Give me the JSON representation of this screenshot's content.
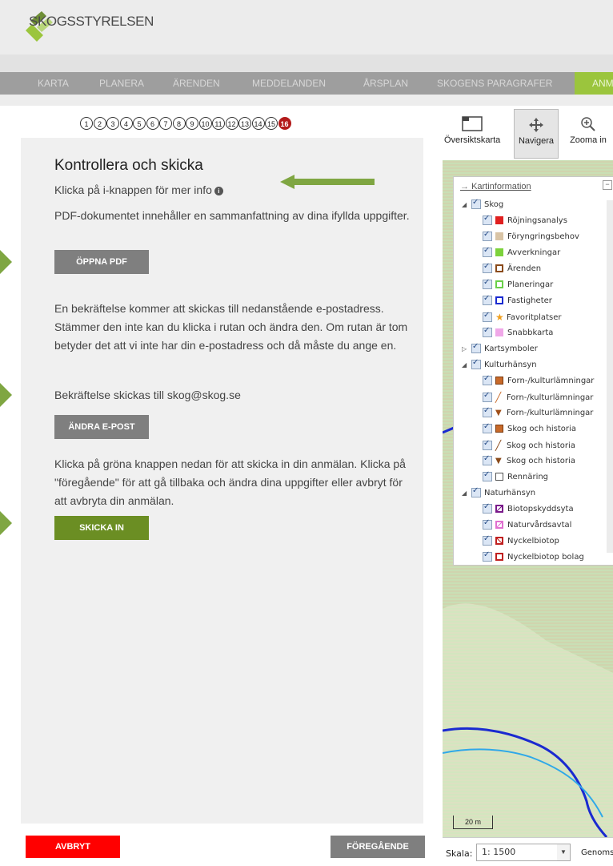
{
  "header": {
    "logo_text": "SKOGSSTYRELSEN"
  },
  "nav": {
    "items": [
      "KARTA",
      "PLANERA",
      "ÄRENDEN",
      "MEDDELANDEN",
      "ÅRSPLAN",
      "SKOGENS PARAGRAFER",
      "ANM"
    ]
  },
  "steps": {
    "labels": [
      "1",
      "2",
      "3",
      "4",
      "5",
      "6",
      "7",
      "8",
      "9",
      "10",
      "11",
      "12",
      "13",
      "14",
      "15",
      "16"
    ],
    "active": "16"
  },
  "panel": {
    "title": "Kontrollera och skicka",
    "info_hint": "Klicka på i-knappen för mer info",
    "pdf_text": "PDF-dokumentet innehåller en sammanfattning av dina ifyllda uppgifter.",
    "open_pdf": "ÖPPNA PDF",
    "confirm_text": "En bekräftelse kommer att skickas till nedanstående e-postadress. Stämmer den inte kan du klicka i rutan och ändra den. Om rutan är tom betyder det att vi inte har din e-postadress och då måste du ange en.",
    "confirm_email": "Bekräftelse skickas till skog@skog.se",
    "change_email": "ÄNDRA E-POST",
    "submit_text": "Klicka på gröna knappen nedan för att skicka in din anmälan. Klicka på \"föregående\" för att gå tillbaka och ändra dina uppgifter eller avbryt för att avbryta din anmälan.",
    "submit": "SKICKA IN"
  },
  "footer": {
    "cancel": "AVBRYT",
    "previous": "FÖREGÅENDE"
  },
  "map_tools": {
    "overview": "Översiktskarta",
    "navigate": "Navigera",
    "zoom_in": "Zooma in"
  },
  "legend": {
    "title": "Kartinformation",
    "groups": [
      {
        "label": "Skog",
        "items": [
          {
            "label": "Röjningsanalys",
            "color": "#e02020"
          },
          {
            "label": "Föryngringsbehov",
            "color": "#c8a882"
          },
          {
            "label": "Avverkningar",
            "color": "#7dd23c"
          },
          {
            "label": "Ärenden",
            "color": "#8a4a1a"
          },
          {
            "label": "Planeringar",
            "color": "#6ad04a"
          },
          {
            "label": "Fastigheter",
            "color": "#1a2ad0"
          },
          {
            "label": "Favoritplatser",
            "color": "#f0a020"
          },
          {
            "label": "Snabbkarta",
            "color": "#e070d0"
          }
        ]
      },
      {
        "label": "Kartsymboler",
        "items": []
      },
      {
        "label": "Kulturhänsyn",
        "items": [
          {
            "label": "Forn-/kulturlämningar",
            "color": "#c86a2a"
          },
          {
            "label": "Forn-/kulturlämningar",
            "color": "#c86a2a"
          },
          {
            "label": "Forn-/kulturlämningar",
            "color": "#a0501a"
          },
          {
            "label": "Skog och historia",
            "color": "#c86a2a"
          },
          {
            "label": "Skog och historia",
            "color": "#8a4a1a"
          },
          {
            "label": "Skog och historia",
            "color": "#8a4a1a"
          },
          {
            "label": "Rennäring",
            "color": "#555555"
          }
        ]
      },
      {
        "label": "Naturhänsyn",
        "items": [
          {
            "label": "Biotopskyddsyta",
            "color": "#7a1a8a"
          },
          {
            "label": "Naturvårdsavtal",
            "color": "#e070d0"
          },
          {
            "label": "Nyckelbiotop",
            "color": "#c02020"
          },
          {
            "label": "Nyckelbiotop bolag",
            "color": "#c02020"
          }
        ]
      }
    ]
  },
  "scale": {
    "label": "Skala:",
    "value": "1: 1500",
    "extra": "Genoms",
    "bar_label": "20 m"
  }
}
